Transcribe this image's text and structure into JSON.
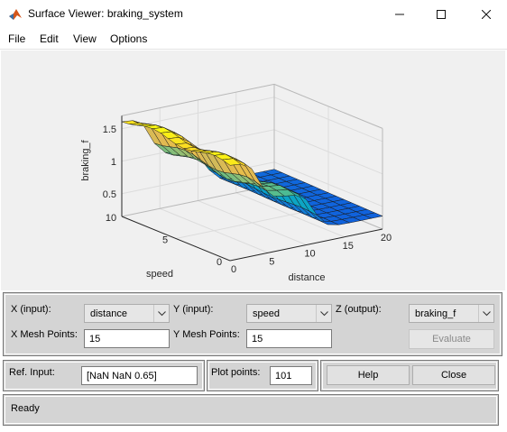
{
  "window": {
    "title": "Surface Viewer: braking_system"
  },
  "menu": [
    "File",
    "Edit",
    "View",
    "Options"
  ],
  "plot": {
    "zlabel": "braking_f",
    "xlabel": "distance",
    "ylabel": "speed",
    "x_ticks": [
      "0",
      "5",
      "10",
      "15",
      "20"
    ],
    "y_ticks": [
      "0",
      "5",
      "10"
    ],
    "z_ticks": [
      "0.5",
      "1",
      "1.5"
    ]
  },
  "chart_data": {
    "type": "surface",
    "x": [
      0,
      20
    ],
    "y": [
      0,
      10
    ],
    "zlim": [
      0.15,
      1.7
    ],
    "colormap": "parula"
  },
  "controls": {
    "x_input_label": "X (input):",
    "x_input_value": "distance",
    "y_input_label": "Y (input):",
    "y_input_value": "speed",
    "z_output_label": "Z (output):",
    "z_output_value": "braking_f",
    "x_mesh_label": "X Mesh Points:",
    "x_mesh_value": "15",
    "y_mesh_label": "Y Mesh Points:",
    "y_mesh_value": "15",
    "evaluate_label": "Evaluate",
    "ref_input_label": "Ref. Input:",
    "ref_input_value": "[NaN NaN 0.65]",
    "plot_points_label": "Plot points:",
    "plot_points_value": "101",
    "help_label": "Help",
    "close_label": "Close"
  },
  "status": {
    "text": "Ready"
  }
}
